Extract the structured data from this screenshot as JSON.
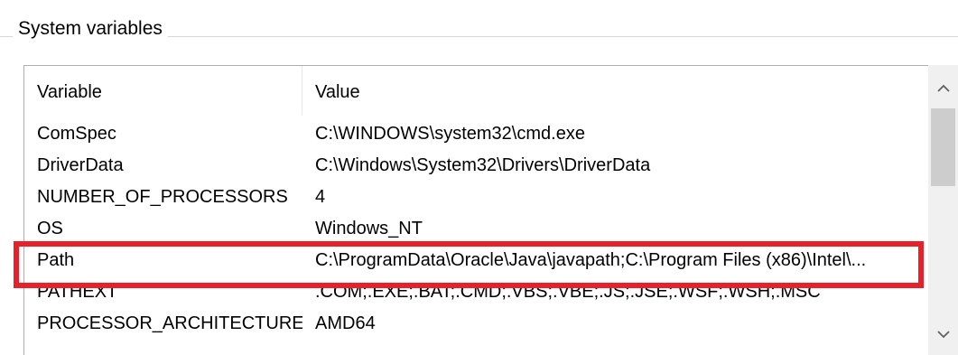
{
  "group": {
    "label": "System variables"
  },
  "list": {
    "headers": {
      "variable": "Variable",
      "value": "Value"
    },
    "rows": [
      {
        "variable": "ComSpec",
        "value": "C:\\WINDOWS\\system32\\cmd.exe"
      },
      {
        "variable": "DriverData",
        "value": "C:\\Windows\\System32\\Drivers\\DriverData"
      },
      {
        "variable": "NUMBER_OF_PROCESSORS",
        "value": "4"
      },
      {
        "variable": "OS",
        "value": "Windows_NT"
      },
      {
        "variable": "Path",
        "value": "C:\\ProgramData\\Oracle\\Java\\javapath;C:\\Program Files (x86)\\Intel\\..."
      },
      {
        "variable": "PATHEXT",
        "value": ".COM;.EXE;.BAT;.CMD;.VBS;.VBE;.JS;.JSE;.WSF;.WSH;.MSC"
      },
      {
        "variable": "PROCESSOR_ARCHITECTURE",
        "value": "AMD64"
      }
    ]
  },
  "scrollbar": {
    "up_icon": "chevron-up-icon",
    "down_icon": "chevron-down-icon"
  },
  "annotation": {
    "highlighted_row": "Path",
    "color": "#e8202a"
  }
}
